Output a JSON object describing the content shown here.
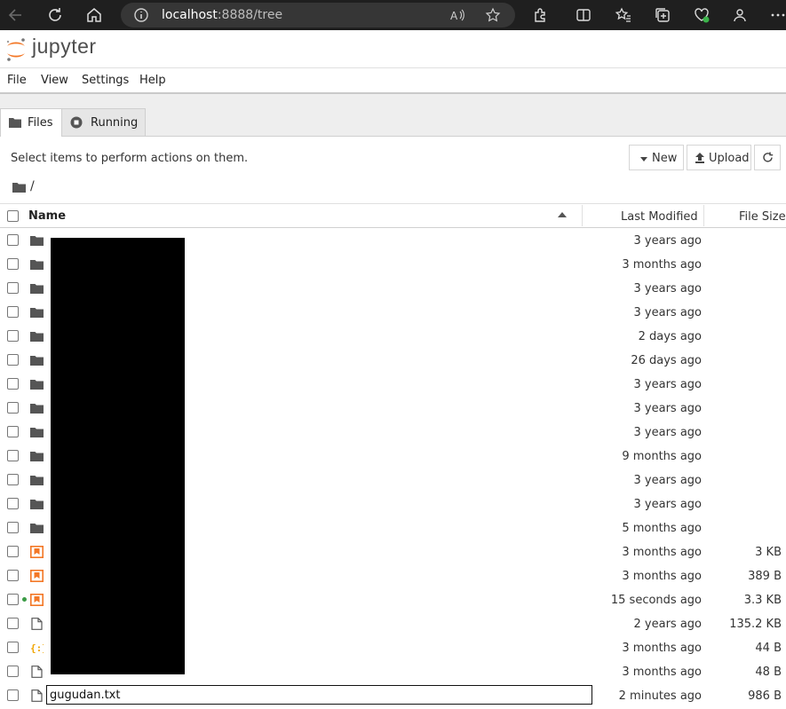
{
  "browser": {
    "url_host": "localhost",
    "url_rest": ":8888/tree"
  },
  "app": {
    "logo_text": "jupyter"
  },
  "menu": [
    "File",
    "View",
    "Settings",
    "Help"
  ],
  "tabs": [
    {
      "label": "Files",
      "active": true
    },
    {
      "label": "Running",
      "active": false
    }
  ],
  "toolbar": {
    "hint": "Select items to perform actions on them.",
    "new_label": "New",
    "upload_label": "Upload"
  },
  "breadcrumb": "/",
  "columns": {
    "name": "Name",
    "modified": "Last Modified",
    "size": "File Size"
  },
  "files": [
    {
      "type": "folder",
      "name": "",
      "modified": "3 years ago",
      "size": ""
    },
    {
      "type": "folder",
      "name": "",
      "modified": "3 months ago",
      "size": ""
    },
    {
      "type": "folder",
      "name": "",
      "modified": "3 years ago",
      "size": ""
    },
    {
      "type": "folder",
      "name": "",
      "modified": "3 years ago",
      "size": ""
    },
    {
      "type": "folder",
      "name": "",
      "modified": "2 days ago",
      "size": ""
    },
    {
      "type": "folder",
      "name": "",
      "modified": "26 days ago",
      "size": ""
    },
    {
      "type": "folder",
      "name": "",
      "modified": "3 years ago",
      "size": ""
    },
    {
      "type": "folder",
      "name": "",
      "modified": "3 years ago",
      "size": ""
    },
    {
      "type": "folder",
      "name": "",
      "modified": "3 years ago",
      "size": ""
    },
    {
      "type": "folder",
      "name": "",
      "modified": "9 months ago",
      "size": ""
    },
    {
      "type": "folder",
      "name": "",
      "modified": "3 years ago",
      "size": ""
    },
    {
      "type": "folder",
      "name": "",
      "modified": "3 years ago",
      "size": ""
    },
    {
      "type": "folder",
      "name": "",
      "modified": "5 months ago",
      "size": ""
    },
    {
      "type": "notebook",
      "name": "",
      "modified": "3 months ago",
      "size": "3 KB"
    },
    {
      "type": "notebook",
      "name": "",
      "modified": "3 months ago",
      "size": "389 B"
    },
    {
      "type": "notebook",
      "name": "",
      "modified": "15 seconds ago",
      "size": "3.3 KB",
      "running": true
    },
    {
      "type": "file",
      "name": "",
      "modified": "2 years ago",
      "size": "135.2 KB"
    },
    {
      "type": "json",
      "name": "",
      "modified": "3 months ago",
      "size": "44 B"
    },
    {
      "type": "file",
      "name": "",
      "modified": "3 months ago",
      "size": "48 B"
    },
    {
      "type": "file",
      "name": "gugudan.txt",
      "modified": "2 minutes ago",
      "size": "986 B",
      "renaming": true
    }
  ],
  "colors": {
    "browser_bar": "#1f1f1f",
    "jupyter_orange": "#f37726",
    "running_dot": "#3b9b45"
  }
}
